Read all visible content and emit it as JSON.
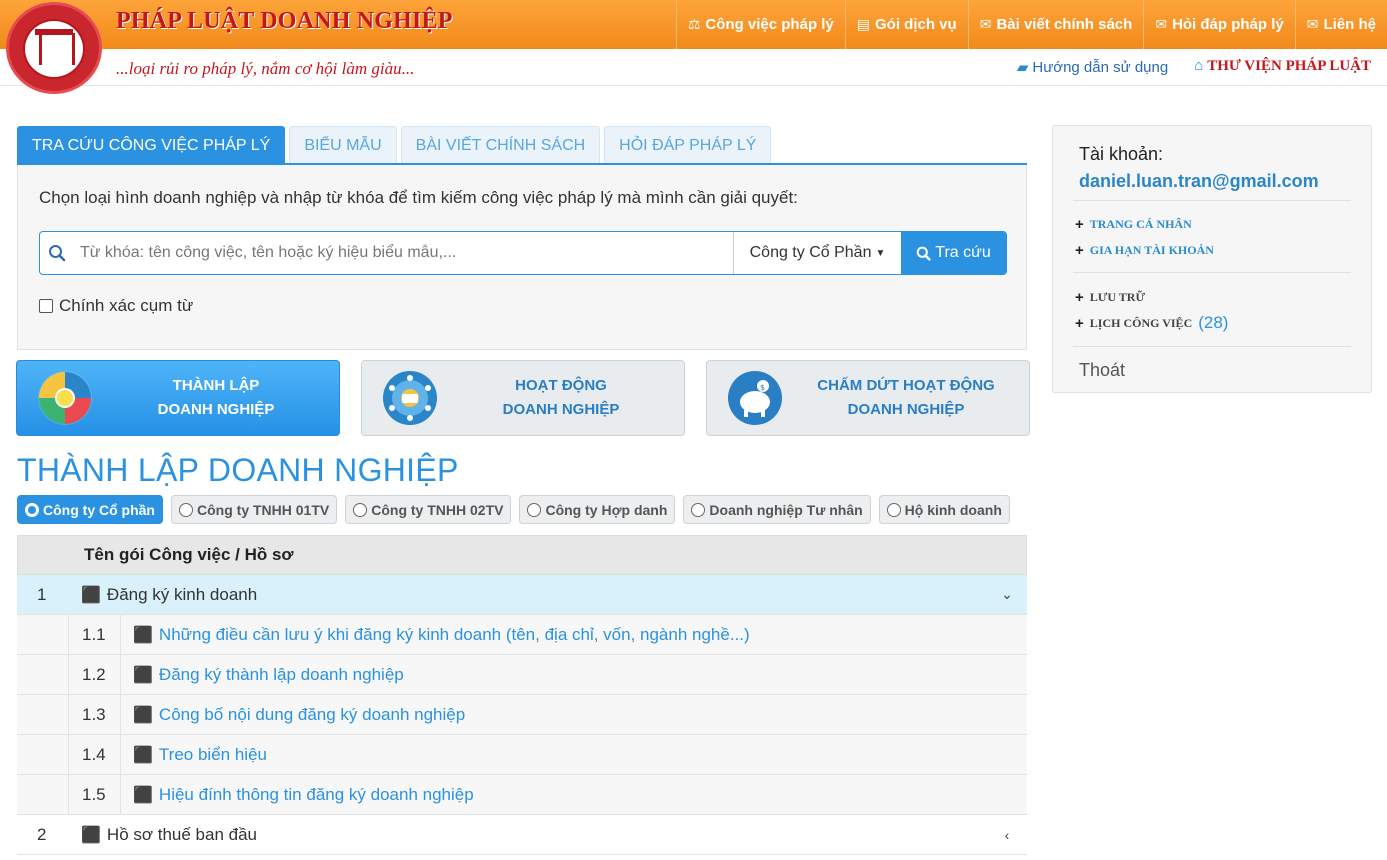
{
  "header": {
    "brand": "PHÁP LUẬT DOANH NGHIỆP",
    "slogan": "...loại rủi ro pháp lý, nắm cơ hội làm giàu...",
    "nav": [
      {
        "icon": "scale-icon",
        "glyph": "⚖",
        "label": "Công việc pháp lý"
      },
      {
        "icon": "newspaper-icon",
        "glyph": "▤",
        "label": "Gói dịch vụ"
      },
      {
        "icon": "envelope-icon",
        "glyph": "✉",
        "label": "Bài viết chính sách"
      },
      {
        "icon": "envelope-icon",
        "glyph": "✉",
        "label": "Hỏi đáp pháp lý"
      },
      {
        "icon": "envelope-icon",
        "glyph": "✉",
        "label": "Liên hệ"
      }
    ],
    "guide_label": "Hướng dẫn sử dụng",
    "library_label": "THƯ VIỆN PHÁP LUẬT"
  },
  "search": {
    "tabs": [
      "TRA CỨU CÔNG VIỆC PHÁP LÝ",
      "BIỂU MẪU",
      "BÀI VIẾT CHÍNH SÁCH",
      "HỎI ĐÁP PHÁP LÝ"
    ],
    "intro": "Chọn loại hình doanh nghiệp và nhập từ khóa để tìm kiếm công việc pháp lý mà mình cần giải quyết:",
    "placeholder": "Từ khóa: tên công việc, tên hoặc ký hiệu biểu mẫu,...",
    "company_type": "Công ty Cổ Phần",
    "button": "Tra cứu",
    "exact_label": "Chính xác cụm từ"
  },
  "categories": [
    {
      "line1": "THÀNH LẬP",
      "line2": "DOANH NGHIỆP"
    },
    {
      "line1": "HOẠT ĐỘNG",
      "line2": "DOANH NGHIỆP"
    },
    {
      "line1": "CHẤM DỨT HOẠT ĐỘNG",
      "line2": "DOANH NGHIỆP"
    }
  ],
  "section_title": "THÀNH LẬP DOANH NGHIỆP",
  "company_filters": [
    "Công ty Cổ phần",
    "Công ty TNHH 01TV",
    "Công ty TNHH 02TV",
    "Công ty Hợp danh",
    "Doanh nghiệp Tư nhân",
    "Hộ kinh doanh"
  ],
  "table": {
    "header": "Tên gói Công việc / Hồ sơ",
    "groups": [
      {
        "num": "1",
        "name": "Đăng ký kinh doanh",
        "arrow": "⌄",
        "items": [
          {
            "num": "1.1",
            "name": "Những điều cần lưu ý khi đăng ký kinh doanh (tên, địa chỉ, vốn, ngành nghề...)"
          },
          {
            "num": "1.2",
            "name": "Đăng ký thành lập doanh nghiệp"
          },
          {
            "num": "1.3",
            "name": "Công bố nội dung đăng ký doanh nghiệp"
          },
          {
            "num": "1.4",
            "name": "Treo biển hiệu"
          },
          {
            "num": "1.5",
            "name": "Hiệu đính thông tin đăng ký doanh nghiệp"
          }
        ]
      },
      {
        "num": "2",
        "name": "Hồ sơ thuế ban đầu",
        "arrow": "‹"
      }
    ]
  },
  "account": {
    "label": "Tài khoản:",
    "email": "daniel.luan.tran@gmail.com",
    "profile": "TRANG CÁ NHÂN",
    "renew": "GIA HẠN TÀI KHOẢN",
    "archive": "LƯU TRỮ",
    "calendar": "LỊCH CÔNG VIỆC",
    "calendar_count": "(28)",
    "logout": "Thoát"
  },
  "colors": {
    "orange": "#f2891c",
    "brand_red": "#c4161c",
    "blue": "#2a92e0"
  }
}
